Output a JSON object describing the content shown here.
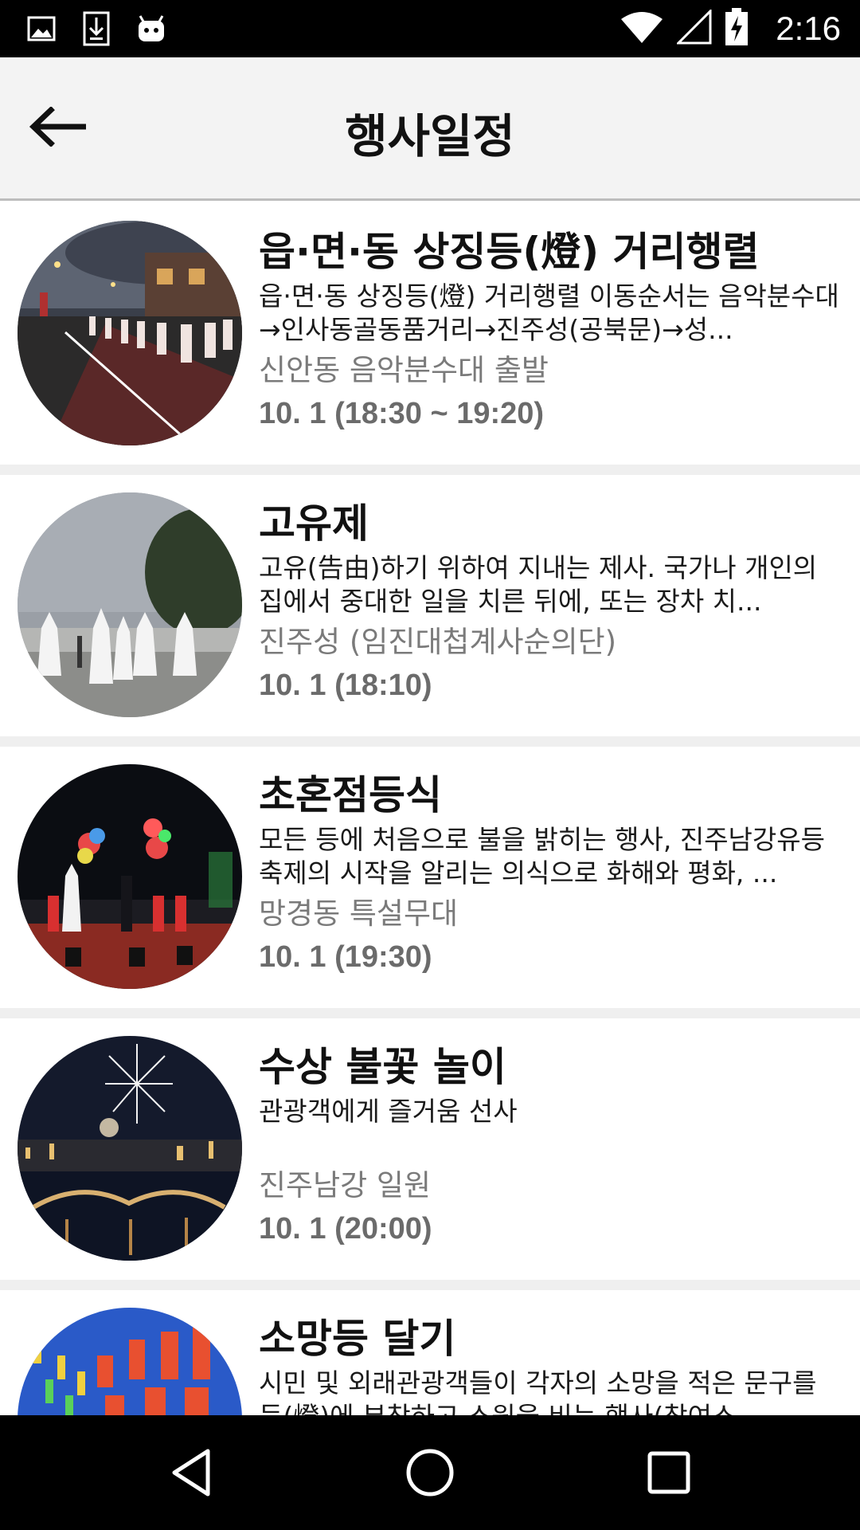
{
  "status_bar": {
    "time": "2:16",
    "icons": [
      "image-icon",
      "download-icon",
      "android-icon",
      "wifi-icon",
      "signal-icon",
      "battery-charging-icon"
    ]
  },
  "app_bar": {
    "title": "행사일정",
    "back_icon": "back-arrow-icon"
  },
  "events": [
    {
      "title": "읍·면·동 상징등(燈) 거리행렬",
      "description": "읍·면·동 상징등(燈) 거리행렬 이동순서는 음악분수대→인사동골동품거리→진주성(공북문)→성...",
      "place": "신안동 음악분수대 출발",
      "time": "10. 1 (18:30 ~ 19:20)"
    },
    {
      "title": "고유제",
      "description": "고유(告由)하기 위하여 지내는 제사. 국가나 개인의 집에서 중대한 일을 치른 뒤에, 또는 장차 치...",
      "place": "진주성 (임진대첩계사순의단)",
      "time": "10. 1 (18:10)"
    },
    {
      "title": "초혼점등식",
      "description": "모든 등에 처음으로 불을 밝히는 행사, 진주남강유등축제의 시작을 알리는 의식으로 화해와 평화, ...",
      "place": "망경동 특설무대",
      "time": "10. 1 (19:30)"
    },
    {
      "title": "수상 불꽃 놀이",
      "description": "관광객에게 즐거움 선사",
      "place": "진주남강 일원",
      "time": "10. 1 (20:00)"
    },
    {
      "title": "소망등 달기",
      "description": "시민 및 외래관광객들이 각자의 소망을 적은 문구를 등(燈)에 부착하고 소원을 비는 행사(참여소",
      "place": "",
      "time": ""
    }
  ],
  "nav_bar": {
    "icons": [
      "back-triangle-icon",
      "home-circle-icon",
      "recents-square-icon"
    ]
  }
}
